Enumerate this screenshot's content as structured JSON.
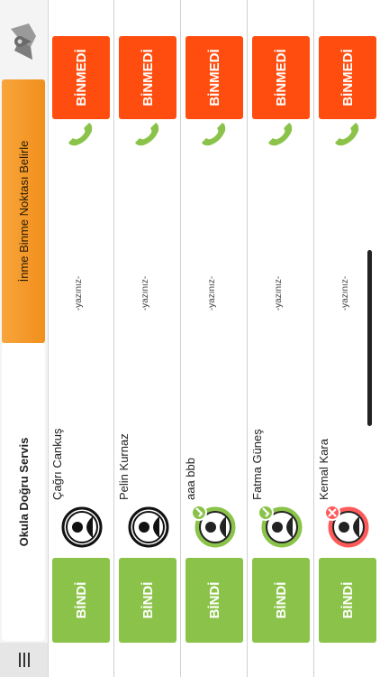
{
  "header": {
    "menu_icon": "hamburger-icon",
    "title": "Okula Doğru Servis",
    "stop_button_label": "İnme Binme Noktası Belirle",
    "map_icon": "map-pin-icon"
  },
  "students": [
    {
      "name": "Çağrı Cankuş",
      "note": "-yazınız-",
      "board_label": "BİNDİ",
      "absent_label": "BİNMEDİ",
      "status": "none"
    },
    {
      "name": "Pelin Kurnaz",
      "note": "-yazınız-",
      "board_label": "BİNDİ",
      "absent_label": "BİNMEDİ",
      "status": "none"
    },
    {
      "name": "aaa bbb",
      "note": "-yazınız-",
      "board_label": "BİNDİ",
      "absent_label": "BİNMEDİ",
      "status": "boarded"
    },
    {
      "name": "Fatma Güneş",
      "note": "-yazınız-",
      "board_label": "BİNDİ",
      "absent_label": "BİNMEDİ",
      "status": "boarded"
    },
    {
      "name": "Kemal Kara",
      "note": "-yazınız-",
      "board_label": "BİNDİ",
      "absent_label": "BİNMEDİ",
      "status": "absent"
    }
  ],
  "colors": {
    "board_button": "#8bc34a",
    "absent_button": "#ff4d0f",
    "stop_button": "#f39a2b",
    "phone": "#8bc34a",
    "avatar_boarded": "#8bc34a",
    "avatar_absent": "#ff5a5a"
  }
}
